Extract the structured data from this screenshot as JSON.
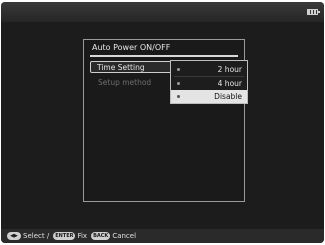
{
  "dialog": {
    "title": "Auto Power ON/OFF",
    "menu": [
      {
        "label": "Time Setting",
        "state": "focused"
      },
      {
        "label": "Setup method",
        "state": "disabled"
      }
    ]
  },
  "options": {
    "items": [
      "2 hour",
      "4 hour",
      "Disable"
    ],
    "selected": "Disable"
  },
  "footer": {
    "arrows_key": "◀▶",
    "select_label": "Select /",
    "enter_key": "ENTER",
    "fix_label": "Fix",
    "back_key": "BACK",
    "cancel_label": "Cancel"
  },
  "colors": {
    "screen_bg": "#1c1c1c",
    "highlight": "#e4e4e4",
    "text": "#e6e6e6",
    "disabled_text": "#6e6e6e"
  },
  "icons": [
    "battery-icon",
    "bullet-icon"
  ]
}
